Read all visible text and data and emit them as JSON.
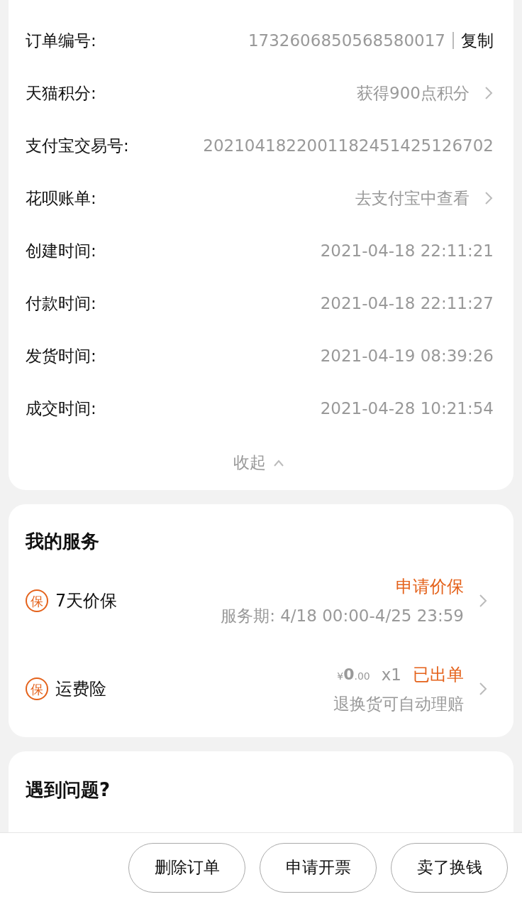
{
  "order_info": {
    "rows": [
      {
        "kind": "copy",
        "label": "订单编号:",
        "value": "1732606850568580017",
        "action": "复制"
      },
      {
        "kind": "link",
        "label": "天猫积分:",
        "value": "获得900点积分"
      },
      {
        "kind": "plain",
        "label": "支付宝交易号:",
        "value": "2021041822001182451425126702"
      },
      {
        "kind": "link",
        "label": "花呗账单:",
        "value": "去支付宝中查看"
      },
      {
        "kind": "plain",
        "label": "创建时间:",
        "value": "2021-04-18 22:11:21"
      },
      {
        "kind": "plain",
        "label": "付款时间:",
        "value": "2021-04-18 22:11:27"
      },
      {
        "kind": "plain",
        "label": "发货时间:",
        "value": "2021-04-19 08:39:26"
      },
      {
        "kind": "plain",
        "label": "成交时间:",
        "value": "2021-04-28 10:21:54"
      }
    ],
    "collapse_label": "收起",
    "expanded": true
  },
  "services": {
    "title": "我的服务",
    "items": [
      {
        "kind": "action",
        "badge": "保",
        "name": "7天价保",
        "status": "申请价保",
        "detail": "服务期: 4/18 00:00-4/25 23:59"
      },
      {
        "kind": "policy",
        "badge": "保",
        "name": "运费险",
        "price_symbol": "¥",
        "price_integer": "0",
        "price_decimal": ".00",
        "quantity": "x1",
        "status": "已出单",
        "detail": "退换货可自动理赔"
      }
    ]
  },
  "help": {
    "title": "遇到问题?"
  },
  "bottom_buttons": [
    "删除订单",
    "申请开票",
    "卖了换钱"
  ]
}
